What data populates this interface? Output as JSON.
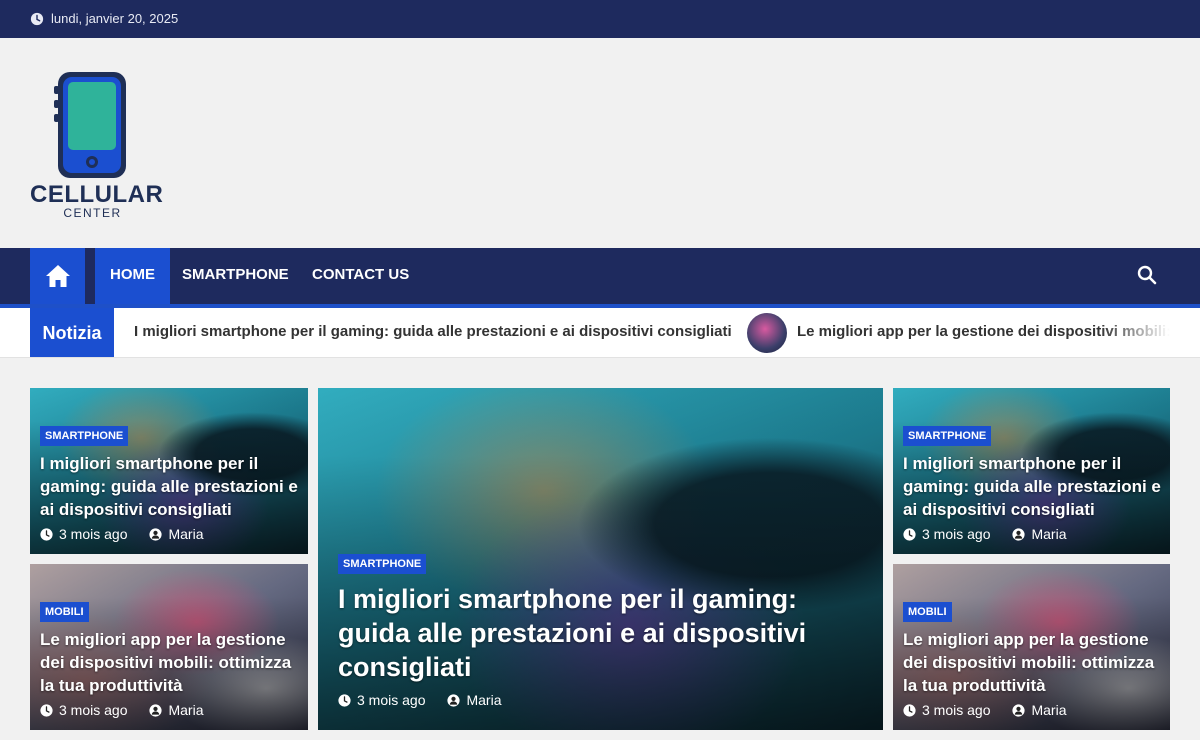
{
  "topbar": {
    "date": "lundi, janvier 20, 2025"
  },
  "logo": {
    "brand": "CELLULAR",
    "sub": "CENTER"
  },
  "nav": {
    "items": [
      {
        "label": "HOME"
      },
      {
        "label": "SMARTPHONE"
      },
      {
        "label": "CONTACT US"
      }
    ]
  },
  "ticker": {
    "label": "Notizia",
    "items": [
      "I migliori smartphone per il gaming: guida alle prestazioni e ai dispositivi consigliati",
      "Le migliori app per la gestione dei dispositivi mobili: ottimizza la tua produttività"
    ]
  },
  "posts": [
    {
      "category": "SMARTPHONE",
      "title": "I migliori smartphone per il gaming: guida alle prestazioni e ai dispositivi consigliati",
      "date": "3 mois ago",
      "author": "Maria"
    },
    {
      "category": "MOBILI",
      "title": "Le migliori app per la gestione dei dispositivi mobili: ottimizza la tua produttività",
      "date": "3 mois ago",
      "author": "Maria"
    },
    {
      "category": "SMARTPHONE",
      "title": "I migliori smartphone per il gaming: guida alle prestazioni e ai dispositivi consigliati",
      "date": "3 mois ago",
      "author": "Maria"
    },
    {
      "category": "SMARTPHONE",
      "title": "I migliori smartphone per il gaming: guida alle prestazioni e ai dispositivi consigliati",
      "date": "3 mois ago",
      "author": "Maria"
    },
    {
      "category": "MOBILI",
      "title": "Le migliori app per la gestione dei dispositivi mobili: ottimizza la tua produttività",
      "date": "3 mois ago",
      "author": "Maria"
    }
  ],
  "colors": {
    "navy": "#1e2a5e",
    "accent": "#1b4fd0"
  }
}
